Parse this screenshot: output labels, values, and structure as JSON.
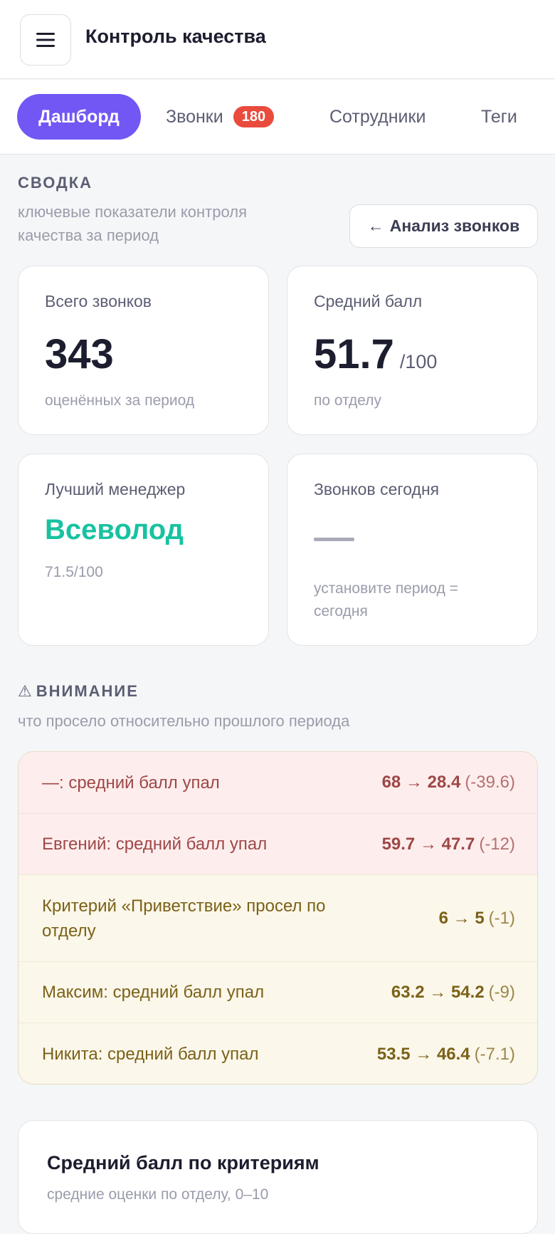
{
  "header": {
    "title": "Контроль качества",
    "menu_icon": "hamburger-icon"
  },
  "tabs": [
    {
      "label": "Дашборд",
      "active": true
    },
    {
      "label": "Звонки",
      "badge": "180"
    },
    {
      "label": "Сотрудники"
    },
    {
      "label": "Теги"
    }
  ],
  "summary": {
    "title": "СВОДКА",
    "subtitle_line1": "ключевые показатели контроля",
    "subtitle_line2": "качества за период",
    "button_label": "Анализ звонков",
    "button_icon": "←"
  },
  "cards": {
    "total": {
      "label": "Всего звонков",
      "value": "343",
      "note": "оценённых за период"
    },
    "avg": {
      "label": "Средний балл",
      "value": "51.7",
      "unit": "/100",
      "note": "по отделу"
    },
    "best": {
      "label": "Лучший менеджер",
      "name": "Всеволод",
      "note": "71.5/100"
    },
    "today": {
      "label": "Звонков сегодня",
      "value": "—",
      "note_line1": "установите период =",
      "note_line2": "сегодня"
    }
  },
  "attention": {
    "icon": "⚠",
    "title": "ВНИМАНИЕ",
    "subtitle": "что просело относительно прошлого периода",
    "items": [
      {
        "text": "—: средний балл упал",
        "values": "68 → 28.4",
        "change": "(-39.6)",
        "severity": "red"
      },
      {
        "text": "Евгений: средний балл упал",
        "values": "59.7 → 47.7",
        "change": "(-12)",
        "severity": "red"
      },
      {
        "text": "Критерий «Приветствие» просел по отделу",
        "values": "6 → 5",
        "change": "(-1)",
        "severity": "yellow"
      },
      {
        "text": "Максим: средний балл упал",
        "values": "63.2 → 54.2",
        "change": "(-9)",
        "severity": "yellow"
      },
      {
        "text": "Никита: средний балл упал",
        "values": "53.5 → 46.4",
        "change": "(-7.1)",
        "severity": "yellow"
      }
    ]
  },
  "criteria": {
    "title": "Средний балл по критериям",
    "subtitle": "средние оценки по отделу, 0–10"
  },
  "colors": {
    "accent": "#7257f5",
    "badge": "#e94b3c",
    "best_manager": "#18c2a0",
    "alert_red_bg": "#fdeeed",
    "alert_yellow_bg": "#fbf7ea"
  }
}
